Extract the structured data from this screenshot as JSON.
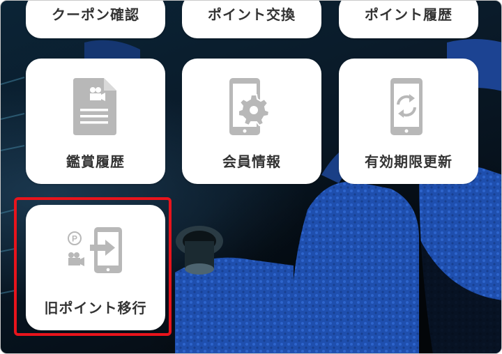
{
  "menu": {
    "top_row": [
      {
        "label": "クーポン確認"
      },
      {
        "label": "ポイント交換"
      },
      {
        "label": "ポイント履歴"
      }
    ],
    "middle_row": [
      {
        "label": "鑑賞履歴",
        "icon": "document-film-icon"
      },
      {
        "label": "会員情報",
        "icon": "phone-gear-icon"
      },
      {
        "label": "有効期限更新",
        "icon": "phone-refresh-icon"
      }
    ],
    "bottom_row": [
      {
        "label": "旧ポイント移行",
        "icon": "point-transfer-icon",
        "highlighted": true
      }
    ]
  },
  "colors": {
    "highlight_border": "#e8141c",
    "icon_gray": "#b8b8b8",
    "label_text": "#333333",
    "seat_blue": "#1e4fb0"
  }
}
